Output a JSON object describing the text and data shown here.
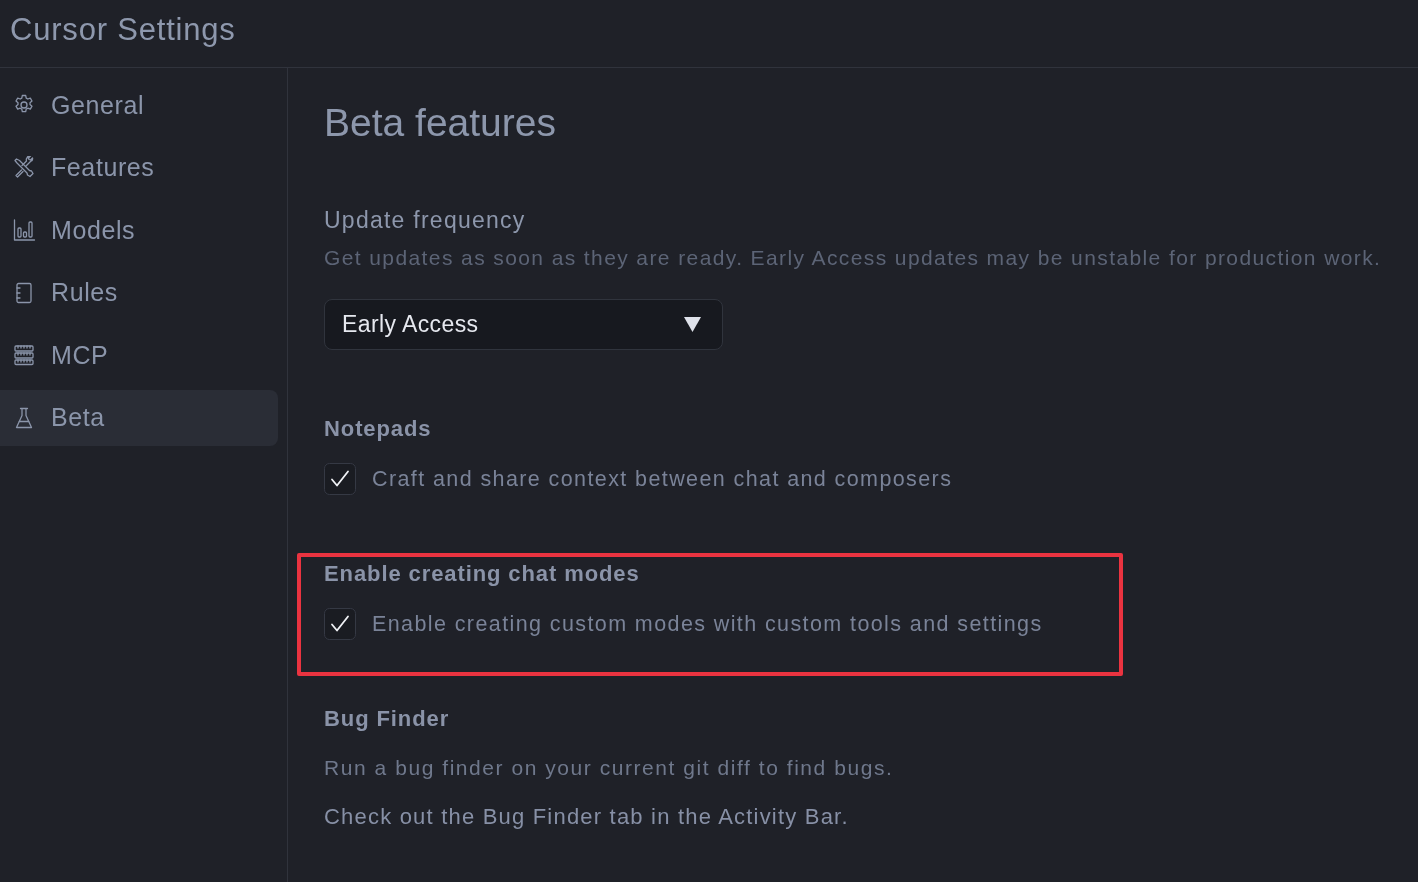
{
  "window": {
    "title": "Cursor Settings"
  },
  "sidebar": {
    "items": [
      {
        "label": "General",
        "selected": false
      },
      {
        "label": "Features",
        "selected": false
      },
      {
        "label": "Models",
        "selected": false
      },
      {
        "label": "Rules",
        "selected": false
      },
      {
        "label": "MCP",
        "selected": false
      },
      {
        "label": "Beta",
        "selected": true
      }
    ]
  },
  "page": {
    "title": "Beta features",
    "sections": [
      {
        "kind": "select",
        "title": "Update frequency",
        "highlighted": false,
        "description": "Get updates as soon as they are ready. Early Access updates may be unstable for production work.",
        "select": {
          "value": "Early Access"
        }
      },
      {
        "kind": "checkbox",
        "title": "Notepads",
        "highlighted": false,
        "checkbox": {
          "label": "Craft and share context between chat and composers",
          "checked": true
        }
      },
      {
        "kind": "checkbox",
        "title": "Enable creating chat modes",
        "highlighted": true,
        "checkbox": {
          "label": "Enable creating custom modes with custom tools and settings",
          "checked": true
        }
      },
      {
        "kind": "text",
        "title": "Bug Finder",
        "highlighted": false,
        "description": "Run a bug finder on your current git diff to find bugs.",
        "note": "Check out the Bug Finder tab in the Activity Bar."
      }
    ]
  }
}
